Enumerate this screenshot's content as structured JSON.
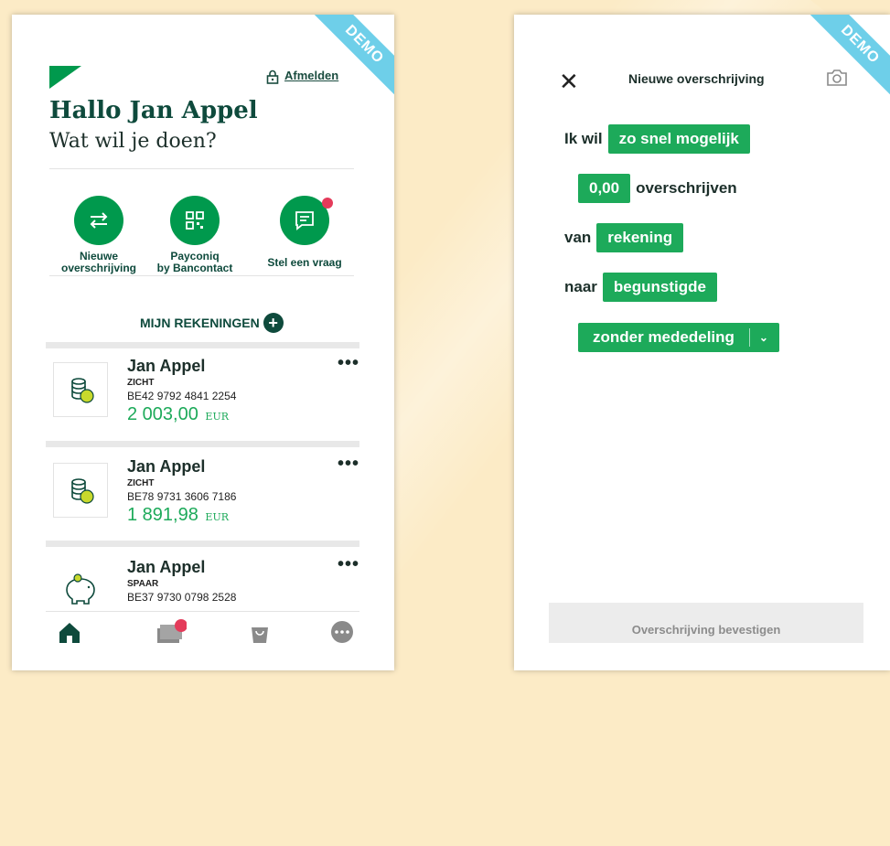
{
  "colors": {
    "brand_green": "#00994d",
    "accent_green": "#1daa5a",
    "dark_green": "#0e4a3c",
    "notification": "#e43b5a",
    "demo_ribbon": "#6ecfe9",
    "background": "#fcebc6"
  },
  "left": {
    "demo_label": "DEMO",
    "logout_label": "Afmelden",
    "greeting_title": "Hallo Jan Appel",
    "greeting_sub": "Wat wil je doen?",
    "quick_actions": [
      {
        "label_line1": "Nieuwe",
        "label_line2": "overschrijving",
        "icon": "transfer-arrows-icon"
      },
      {
        "label_line1": "Payconiq",
        "label_line2": "by Bancontact",
        "icon": "qr-code-icon"
      },
      {
        "label_line1": "Stel een vraag",
        "label_line2": "",
        "icon": "chat-icon"
      }
    ],
    "accounts_title": "MIJN REKENINGEN",
    "accounts": [
      {
        "name": "Jan Appel",
        "type": "ZICHT",
        "iban": "BE42 9792 4841 2254",
        "balance": "2 003,00",
        "currency": "EUR",
        "icon": "coins-icon"
      },
      {
        "name": "Jan Appel",
        "type": "ZICHT",
        "iban": "BE78 9731 3606 7186",
        "balance": "1 891,98",
        "currency": "EUR",
        "icon": "coins-icon"
      },
      {
        "name": "Jan Appel",
        "type": "SPAAR",
        "iban": "BE37 9730 0798 2528",
        "balance": "",
        "currency": "",
        "icon": "piggy-bank-icon"
      }
    ],
    "more_label": "•••",
    "bottom_nav": [
      "home-icon",
      "cards-icon",
      "shopping-bag-icon",
      "more-icon"
    ]
  },
  "right": {
    "demo_label": "DEMO",
    "close_label": "✕",
    "title": "Nieuwe overschrijving",
    "line1_prefix": "Ik wil",
    "line1_chip": "zo snel mogelijk",
    "line2_chip": "0,00",
    "line2_suffix": "overschrijven",
    "line3_prefix": "van",
    "line3_chip": "rekening",
    "line4_prefix": "naar",
    "line4_chip": "begunstigde",
    "line5_select": "zonder mededeling",
    "confirm_label": "Overschrijving bevestigen"
  }
}
